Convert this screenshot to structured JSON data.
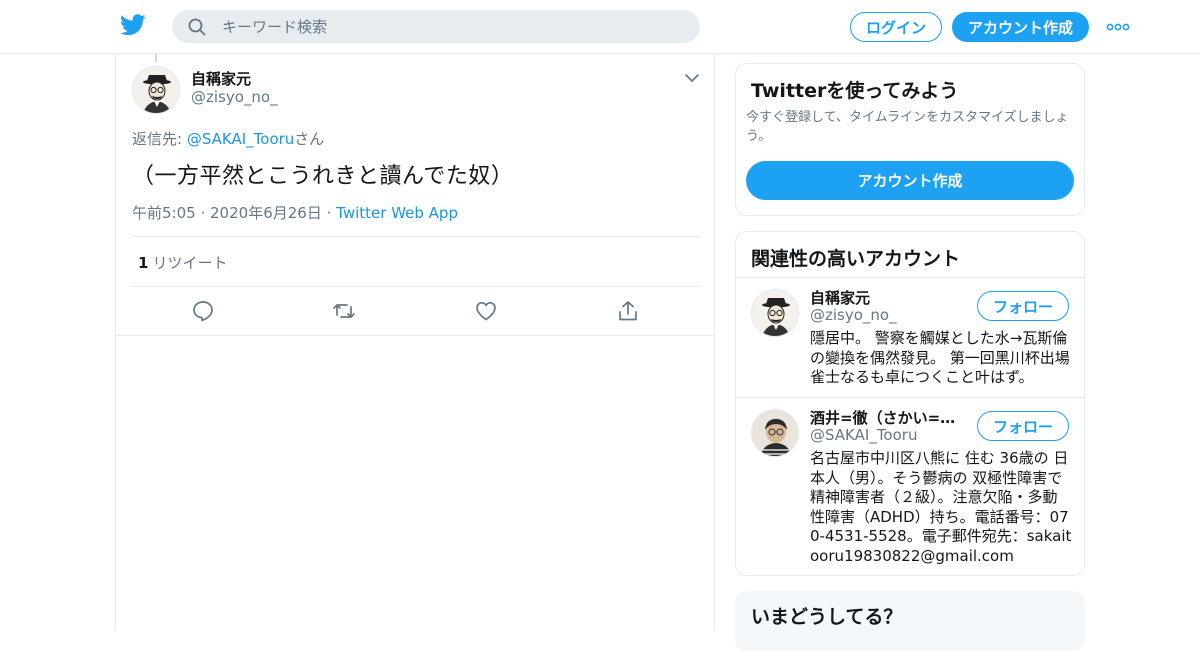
{
  "header": {
    "search_placeholder": "キーワード検索",
    "login_label": "ログイン",
    "signup_label": "アカウント作成"
  },
  "tweet": {
    "author_name": "自稱家元",
    "author_handle": "@zisyo_no_",
    "reply_prefix": "返信先: ",
    "reply_mention": "@SAKAI_Tooru",
    "reply_suffix": "さん",
    "text": "（一方平然とこうれきと讀んでた奴）",
    "time": "午前5:05",
    "date": "2020年6月26日",
    "source": "Twitter Web App",
    "retweet_count": "1",
    "retweet_label": "リツイート"
  },
  "signup_card": {
    "title": "Twitterを使ってみよう",
    "description": "今すぐ登録して、タイムラインをカスタマイズしましょう。",
    "button_label": "アカウント作成"
  },
  "related": {
    "title": "関連性の高いアカウント",
    "accounts": [
      {
        "name": "自稱家元",
        "handle": "@zisyo_no_",
        "bio": "隱居中。 警察を觸媒とした水→瓦斯倫の變換を偶然發見。 第一回黑川杯出場雀士なるも卓につくこと叶はず。",
        "follow_label": "フォロー"
      },
      {
        "name": "酒井=徹（さかい=とおる）",
        "handle": "@SAKAI_Tooru",
        "bio": "名古屋市中川区八熊に 住む 36歳の 日本人（男）。そう鬱病の 双極性障害で 精神障害者（２級）。注意欠陥・多動性障害（ADHD）持ち。電話番号：070-4531-5528。電子郵件宛先：sakaitooru19830822@gmail.com",
        "follow_label": "フォロー"
      }
    ]
  },
  "trends": {
    "title": "いまどうしてる？"
  },
  "colors": {
    "brand": "#1da1f2",
    "link": "#1b95e0",
    "muted": "#657786",
    "border": "#e6ecf0"
  },
  "icons": [
    "twitter-logo-icon",
    "search-icon",
    "more-icon",
    "chevron-down-icon",
    "reply-icon",
    "retweet-icon",
    "like-icon",
    "share-icon"
  ]
}
